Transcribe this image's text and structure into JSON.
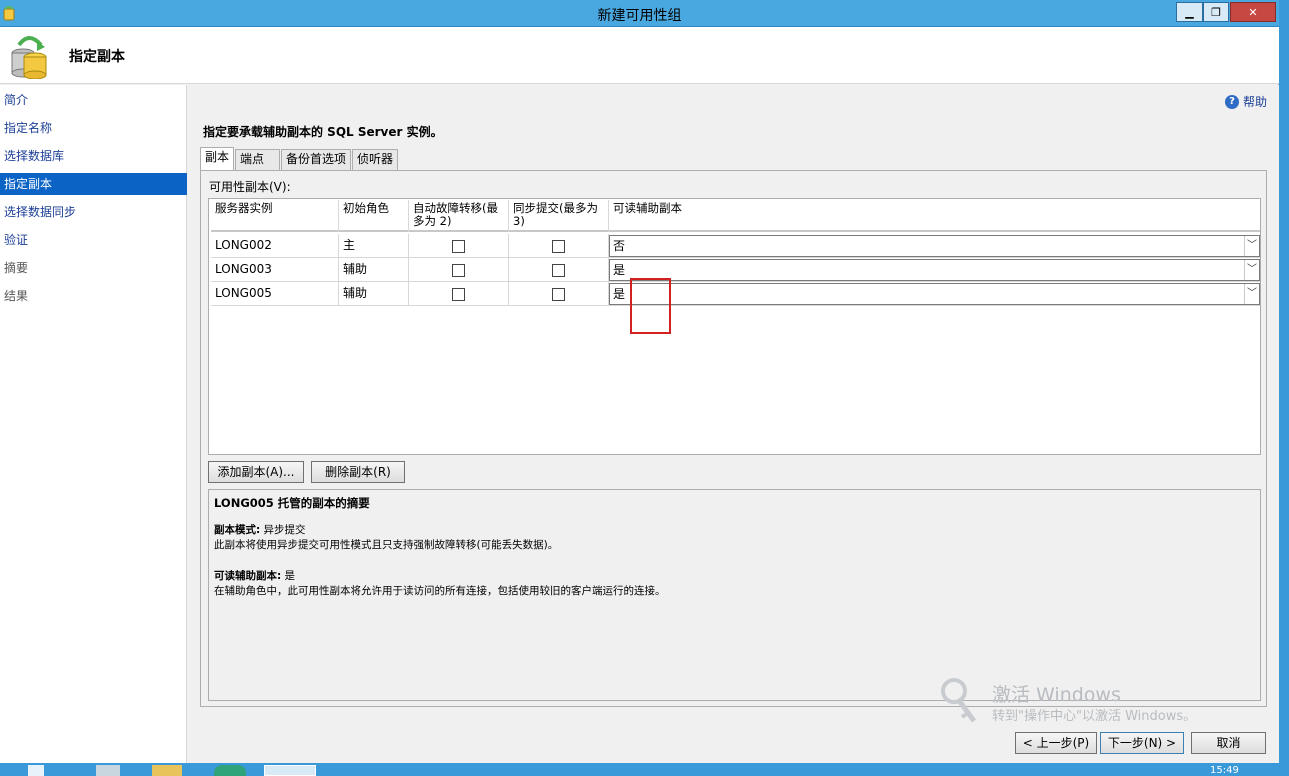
{
  "window": {
    "title": "新建可用性组"
  },
  "header": {
    "page_title": "指定副本"
  },
  "sidebar": {
    "items": [
      {
        "label": "简介"
      },
      {
        "label": "指定名称"
      },
      {
        "label": "选择数据库"
      },
      {
        "label": "指定副本",
        "active": true
      },
      {
        "label": "选择数据同步"
      },
      {
        "label": "验证"
      },
      {
        "label": "摘要"
      },
      {
        "label": "结果"
      }
    ]
  },
  "content": {
    "help_label": "帮助",
    "instruction": "指定要承载辅助副本的 SQL Server 实例。",
    "tabs": [
      "副本",
      "端点",
      "备份首选项",
      "侦听器"
    ],
    "available_replicas_label": "可用性副本(V):",
    "grid": {
      "headers": [
        "服务器实例",
        "初始角色",
        "自动故障转移(最多为 2)",
        "同步提交(最多为 3)",
        "可读辅助副本"
      ],
      "rows": [
        {
          "server": "LONG002",
          "role": "主",
          "auto_failover": false,
          "sync_commit": false,
          "readable": "否"
        },
        {
          "server": "LONG003",
          "role": "辅助",
          "auto_failover": false,
          "sync_commit": false,
          "readable": "是"
        },
        {
          "server": "LONG005",
          "role": "辅助",
          "auto_failover": false,
          "sync_commit": false,
          "readable": "是"
        }
      ]
    },
    "add_button": "添加副本(A)...",
    "remove_button": "删除副本(R)",
    "summary": {
      "title": "LONG005 托管的副本的摘要",
      "mode_label": "副本模式:",
      "mode_value": "异步提交",
      "mode_desc": "此副本将使用异步提交可用性模式且只支持强制故障转移(可能丢失数据)。",
      "readable_label": "可读辅助副本:",
      "readable_value": "是",
      "readable_desc": "在辅助角色中，此可用性副本将允许用于读访问的所有连接，包括使用较旧的客户端运行的连接。"
    }
  },
  "footer": {
    "prev_button": "< 上一步(P)",
    "next_button": "下一步(N) >",
    "cancel_button": "取消"
  },
  "watermark": {
    "line1": "激活 Windows",
    "line2": "转到\"操作中心\"以激活 Windows。"
  },
  "taskbar": {
    "clock": "15:49"
  },
  "colors": {
    "accent": "#0b63c6",
    "titlebar": "#4aa8e0",
    "highlight": "#d32020"
  }
}
